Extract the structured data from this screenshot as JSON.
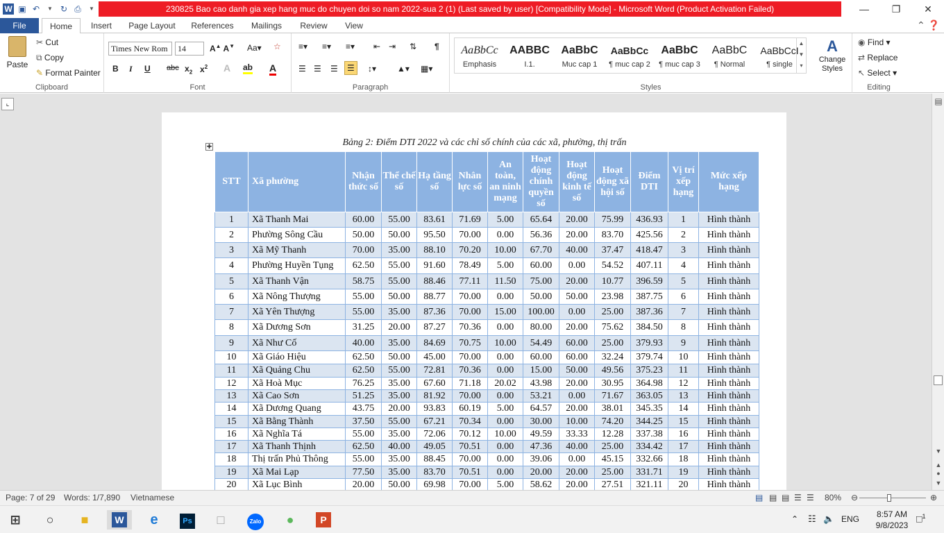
{
  "titlebar": {
    "title": "230825 Bao cao danh gia xep hang muc do chuyen doi so nam 2022-sua 2 (1) (Last saved by user) [Compatibility Mode]  -  Microsoft Word (Product Activation Failed)",
    "word_logo": "W",
    "accent": "#ee1c25"
  },
  "tabs": {
    "file": "File",
    "items": [
      "Home",
      "Insert",
      "Page Layout",
      "References",
      "Mailings",
      "Review",
      "View"
    ]
  },
  "ribbon": {
    "clipboard": {
      "paste": "Paste",
      "cut": "Cut",
      "copy": "Copy",
      "format_painter": "Format Painter",
      "label": "Clipboard"
    },
    "font": {
      "name": "Times New Rom",
      "size": "14",
      "label": "Font"
    },
    "paragraph": {
      "label": "Paragraph"
    },
    "styles": {
      "label": "Styles",
      "items": [
        {
          "preview": "AaBbCc",
          "name": "Emphasis"
        },
        {
          "preview": "AABBC",
          "name": "I.1."
        },
        {
          "preview": "AaBbC",
          "name": "Muc cap 1"
        },
        {
          "preview": "AaBbCc",
          "name": "¶ muc cap 2"
        },
        {
          "preview": "AaBbC",
          "name": "¶ muc cap 3"
        },
        {
          "preview": "AaBbC",
          "name": "¶ Normal"
        },
        {
          "preview": "AaBbCcI",
          "name": "¶ single"
        }
      ],
      "change_styles": "Change Styles"
    },
    "editing": {
      "find": "Find",
      "replace": "Replace",
      "select": "Select",
      "label": "Editing"
    }
  },
  "document": {
    "caption": "Bảng 2: Điểm DTI 2022 và các chỉ số chính của các xã, phường, thị trấn",
    "headers": [
      "STT",
      "Xã phường",
      "Nhận thức số",
      "Thể chế số",
      "Hạ tầng số",
      "Nhân lực số",
      "An toàn, an ninh mạng",
      "Hoạt động chính quyền số",
      "Hoạt động kinh tế số",
      "Hoạt động xã hội số",
      "Điểm DTI",
      "Vị trí xếp hạng",
      "Mức xếp hạng"
    ],
    "rows": [
      [
        "1",
        "Xã Thanh Mai",
        "60.00",
        "55.00",
        "83.61",
        "71.69",
        "5.00",
        "65.64",
        "20.00",
        "75.99",
        "436.93",
        "1",
        "Hình thành"
      ],
      [
        "2",
        "Phường Sông Cầu",
        "50.00",
        "50.00",
        "95.50",
        "70.00",
        "0.00",
        "56.36",
        "20.00",
        "83.70",
        "425.56",
        "2",
        "Hình thành"
      ],
      [
        "3",
        "Xã Mỹ Thanh",
        "70.00",
        "35.00",
        "88.10",
        "70.20",
        "10.00",
        "67.70",
        "40.00",
        "37.47",
        "418.47",
        "3",
        "Hình thành"
      ],
      [
        "4",
        "Phường Huyền Tụng",
        "62.50",
        "55.00",
        "91.60",
        "78.49",
        "5.00",
        "60.00",
        "0.00",
        "54.52",
        "407.11",
        "4",
        "Hình thành"
      ],
      [
        "5",
        "Xã Thanh Vận",
        "58.75",
        "55.00",
        "88.46",
        "77.11",
        "11.50",
        "75.00",
        "20.00",
        "10.77",
        "396.59",
        "5",
        "Hình thành"
      ],
      [
        "6",
        "Xã Nông Thượng",
        "55.00",
        "50.00",
        "88.77",
        "70.00",
        "0.00",
        "50.00",
        "50.00",
        "23.98",
        "387.75",
        "6",
        "Hình thành"
      ],
      [
        "7",
        "Xã Yên Thượng",
        "55.00",
        "35.00",
        "87.36",
        "70.00",
        "15.00",
        "100.00",
        "0.00",
        "25.00",
        "387.36",
        "7",
        "Hình thành"
      ],
      [
        "8",
        "Xã Dương Sơn",
        "31.25",
        "20.00",
        "87.27",
        "70.36",
        "0.00",
        "80.00",
        "20.00",
        "75.62",
        "384.50",
        "8",
        "Hình thành"
      ],
      [
        "9",
        "Xã Như Cố",
        "40.00",
        "35.00",
        "84.69",
        "70.75",
        "10.00",
        "54.49",
        "60.00",
        "25.00",
        "379.93",
        "9",
        "Hình thành"
      ],
      [
        "10",
        "Xã Giáo Hiệu",
        "62.50",
        "50.00",
        "45.00",
        "70.00",
        "0.00",
        "60.00",
        "60.00",
        "32.24",
        "379.74",
        "10",
        "Hình thành"
      ],
      [
        "11",
        "Xã Quảng Chu",
        "62.50",
        "55.00",
        "72.81",
        "70.36",
        "0.00",
        "15.00",
        "50.00",
        "49.56",
        "375.23",
        "11",
        "Hình thành"
      ],
      [
        "12",
        "Xã Hoà Mục",
        "76.25",
        "35.00",
        "67.60",
        "71.18",
        "20.02",
        "43.98",
        "20.00",
        "30.95",
        "364.98",
        "12",
        "Hình thành"
      ],
      [
        "13",
        "Xã Cao Sơn",
        "51.25",
        "35.00",
        "81.92",
        "70.00",
        "0.00",
        "53.21",
        "0.00",
        "71.67",
        "363.05",
        "13",
        "Hình thành"
      ],
      [
        "14",
        "Xã Dương Quang",
        "43.75",
        "20.00",
        "93.83",
        "60.19",
        "5.00",
        "64.57",
        "20.00",
        "38.01",
        "345.35",
        "14",
        "Hình thành"
      ],
      [
        "15",
        "Xã Bằng Thành",
        "37.50",
        "55.00",
        "67.21",
        "70.34",
        "0.00",
        "30.00",
        "10.00",
        "74.20",
        "344.25",
        "15",
        "Hình thành"
      ],
      [
        "16",
        "Xã Nghĩa Tá",
        "55.00",
        "35.00",
        "72.06",
        "70.12",
        "10.00",
        "49.59",
        "33.33",
        "12.28",
        "337.38",
        "16",
        "Hình thành"
      ],
      [
        "17",
        "Xã Thanh Thịnh",
        "62.50",
        "40.00",
        "49.05",
        "70.51",
        "0.00",
        "47.36",
        "40.00",
        "25.00",
        "334.42",
        "17",
        "Hình thành"
      ],
      [
        "18",
        "Thị trấn Phủ Thông",
        "55.00",
        "35.00",
        "88.45",
        "70.00",
        "0.00",
        "39.06",
        "0.00",
        "45.15",
        "332.66",
        "18",
        "Hình thành"
      ],
      [
        "19",
        "Xã Mai Lạp",
        "77.50",
        "35.00",
        "83.70",
        "70.51",
        "0.00",
        "20.00",
        "20.00",
        "25.00",
        "331.71",
        "19",
        "Hình thành"
      ],
      [
        "20",
        "Xã Lục Bình",
        "20.00",
        "50.00",
        "69.98",
        "70.00",
        "5.00",
        "58.62",
        "20.00",
        "27.51",
        "321.11",
        "20",
        "Hình thành"
      ]
    ]
  },
  "statusbar": {
    "page": "Page: 7 of 29",
    "words": "Words: 1/7,890",
    "language": "Vietnamese",
    "zoom": "80%"
  },
  "taskbar": {
    "language": "ENG",
    "time": "8:57 AM",
    "date": "9/8/2023",
    "notifications": "1",
    "zalo": "Zalo",
    "word": "W",
    "ps": "Ps"
  }
}
